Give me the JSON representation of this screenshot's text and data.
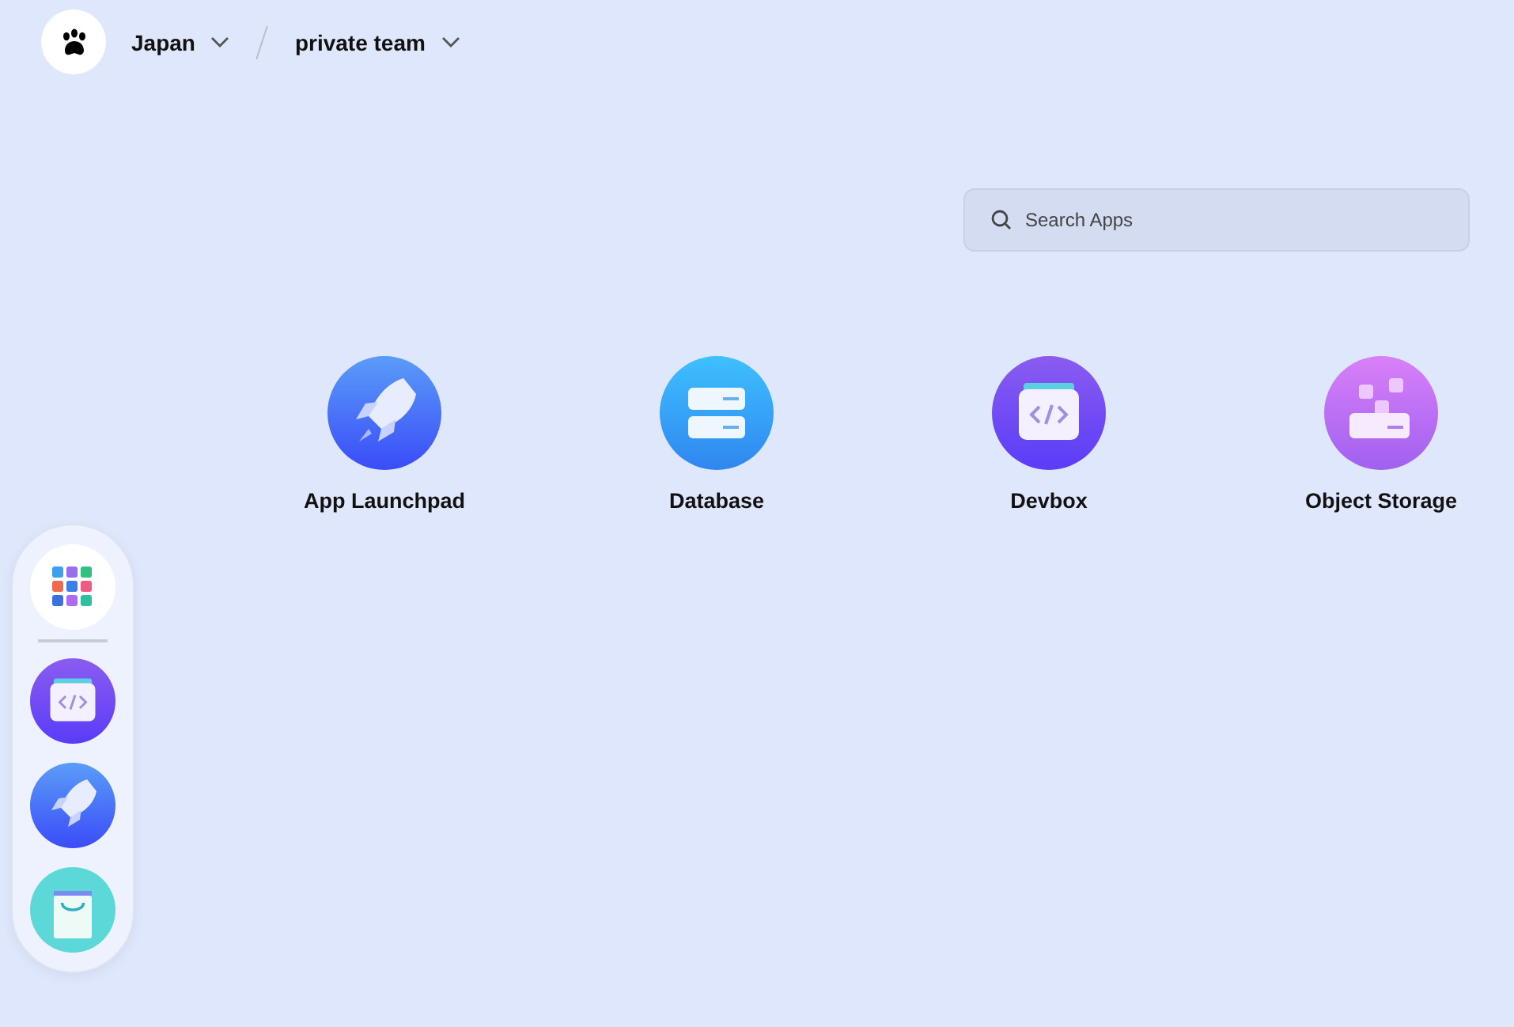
{
  "workspace": {
    "region": "Japan",
    "team": "private team"
  },
  "search": {
    "placeholder": "Search Apps"
  },
  "apps": [
    {
      "kind": "rocket",
      "label": "App Launchpad"
    },
    {
      "kind": "database",
      "label": "Database"
    },
    {
      "kind": "devbox",
      "label": "Devbox"
    },
    {
      "kind": "storage",
      "label": "Object Storage"
    }
  ],
  "dock": [
    {
      "kind": "grid"
    },
    {
      "kind": "devbox"
    },
    {
      "kind": "rocket"
    },
    {
      "kind": "bag"
    }
  ]
}
